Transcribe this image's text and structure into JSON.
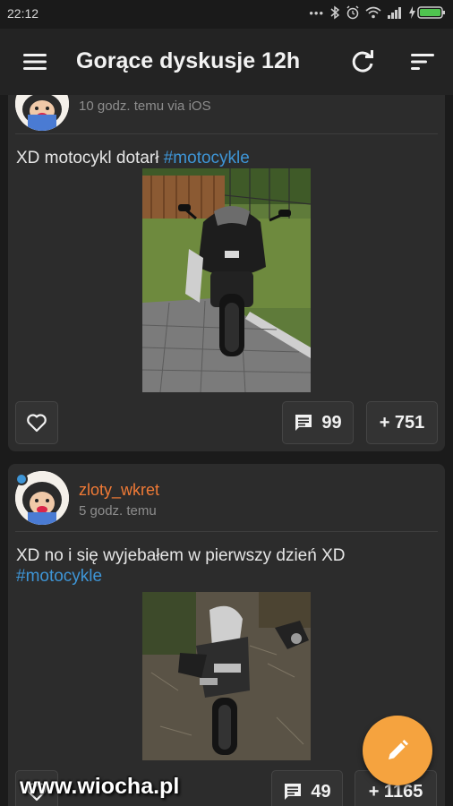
{
  "status_bar": {
    "time": "22:12"
  },
  "app_bar": {
    "title": "Gorące dyskusje 12h"
  },
  "posts": [
    {
      "meta": "10 godz. temu via iOS",
      "text_prefix": "XD motocykl dotarł ",
      "tag": "#motocykle",
      "comments": "99",
      "votes": "+ 751"
    },
    {
      "author": "zloty_wkret",
      "meta": "5 godz. temu",
      "text_prefix": "XD no i się wyjebałem w pierwszy dzień XD",
      "tag": "#motocykle",
      "comments": "49",
      "votes": "+ 1165"
    }
  ],
  "watermark": "www.wiocha.pl",
  "colors": {
    "accent": "#f5a33f",
    "author": "#f07a36",
    "tag": "#3e95d6",
    "card": "#2c2c2c"
  }
}
